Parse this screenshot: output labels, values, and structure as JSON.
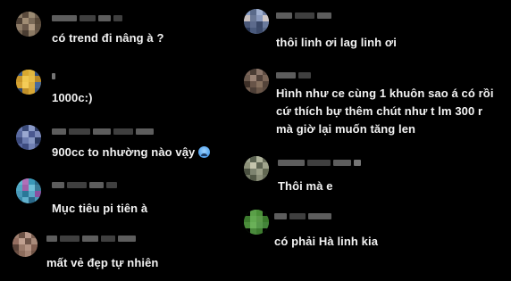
{
  "comments_left": [
    {
      "text": "có trend đi nâng à ?"
    },
    {
      "text": "1000c:)"
    },
    {
      "text": "900cc to nhường nào vậy"
    },
    {
      "text": "Mục tiêu pi tiên à"
    },
    {
      "text": "mất vẻ đẹp tự nhiên"
    }
  ],
  "comments_right": [
    {
      "text": "thôi linh ơi lag linh ơi"
    },
    {
      "lines": [
        "Hình như ce cùng 1 khuôn sao á có rồi",
        "cứ thích bự thêm chút như t lm 300 r",
        "mà giờ lại muốn tăng len"
      ]
    },
    {
      "text": "Thôi mà e"
    },
    {
      "text": "có phải Hà linh kia"
    }
  ],
  "emoji": {
    "icon": "anxious-face-with-sweat-icon"
  },
  "colors": {
    "background": "#000000",
    "text": "#f2f2f2",
    "blurred_name": "#6d6d6d"
  }
}
